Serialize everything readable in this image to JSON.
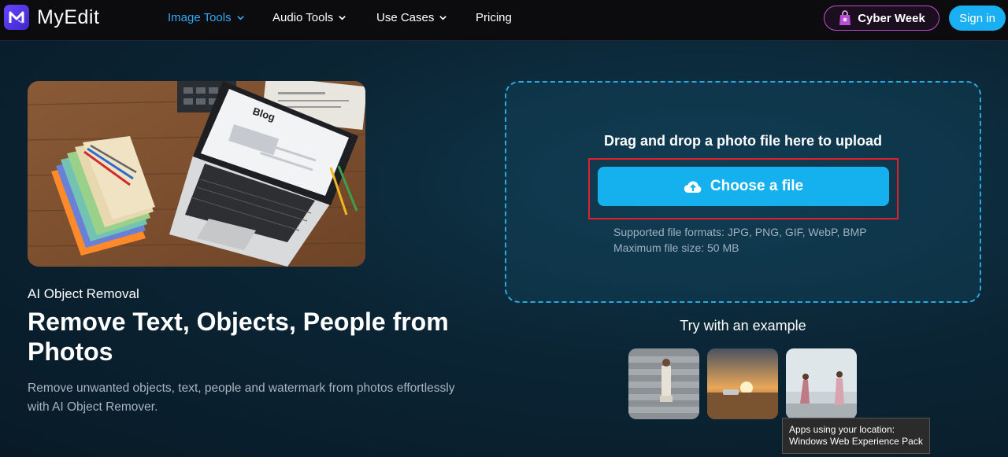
{
  "brand": {
    "name": "MyEdit"
  },
  "nav": {
    "items": [
      {
        "label": "Image Tools",
        "active": true,
        "dropdown": true
      },
      {
        "label": "Audio Tools",
        "active": false,
        "dropdown": true
      },
      {
        "label": "Use Cases",
        "active": false,
        "dropdown": true
      },
      {
        "label": "Pricing",
        "active": false,
        "dropdown": false
      }
    ],
    "cyber_label": "Cyber Week",
    "signin_label": "Sign in"
  },
  "hero": {
    "eyebrow": "AI Object Removal",
    "headline": "Remove Text, Objects, People from Photos",
    "description": "Remove unwanted objects, text, people and watermark from photos effortlessly with AI Object Remover.",
    "image_text": "Blog"
  },
  "upload": {
    "title": "Drag and drop a photo file here to upload",
    "button_label": "Choose a file",
    "formats": "Supported file formats: JPG, PNG, GIF, WebP, BMP",
    "max_size": "Maximum file size: 50 MB"
  },
  "examples": {
    "title": "Try with an example"
  },
  "tooltip": {
    "line1": "Apps using your location:",
    "line2": "Windows Web Experience Pack"
  },
  "colors": {
    "accent": "#1aaef2",
    "active_nav": "#35a9f0",
    "highlight": "#e0202a",
    "cyber_border": "#c44bd0"
  }
}
